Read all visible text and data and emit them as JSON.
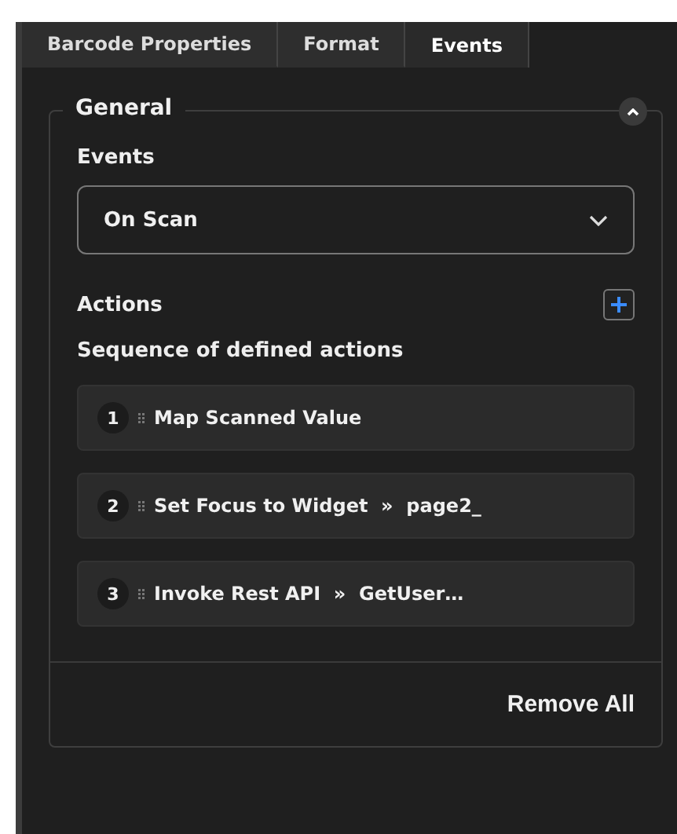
{
  "tabs": [
    {
      "label": "Barcode Properties",
      "selected": false
    },
    {
      "label": "Format",
      "selected": false
    },
    {
      "label": "Events",
      "selected": true
    }
  ],
  "section": {
    "title": "General",
    "expanded": true,
    "events_label": "Events",
    "events_select": {
      "value": "On Scan"
    },
    "actions_label": "Actions",
    "sequence_label": "Sequence of defined actions",
    "actions": [
      {
        "number": "1",
        "text": "Map Scanned Value"
      },
      {
        "number": "2",
        "text": "Set Focus to Widget  »  page2_"
      },
      {
        "number": "3",
        "text": "Invoke Rest API  »  GetUser…"
      }
    ],
    "remove_all": "Remove All"
  }
}
